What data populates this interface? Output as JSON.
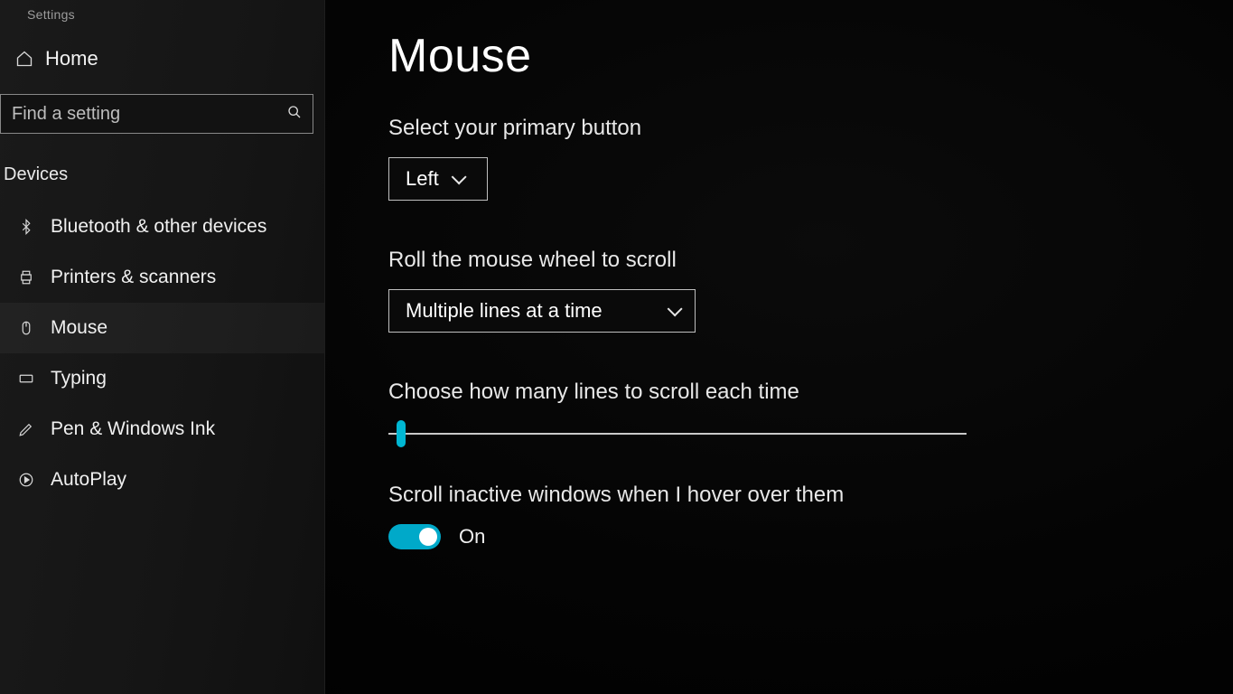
{
  "app": {
    "title": "Settings"
  },
  "sidebar": {
    "home_label": "Home",
    "search_placeholder": "Find a setting",
    "category_label": "Devices",
    "items": [
      {
        "label": "Bluetooth & other devices",
        "icon": "bluetooth"
      },
      {
        "label": "Printers & scanners",
        "icon": "printer"
      },
      {
        "label": "Mouse",
        "icon": "mouse"
      },
      {
        "label": "Typing",
        "icon": "keyboard"
      },
      {
        "label": "Pen & Windows Ink",
        "icon": "pen"
      },
      {
        "label": "AutoPlay",
        "icon": "autoplay"
      }
    ]
  },
  "main": {
    "title": "Mouse",
    "primary_button": {
      "label": "Select your primary button",
      "value": "Left"
    },
    "scroll_mode": {
      "label": "Roll the mouse wheel to scroll",
      "value": "Multiple lines at a time"
    },
    "scroll_lines": {
      "label": "Choose how many lines to scroll each time"
    },
    "scroll_inactive": {
      "label": "Scroll inactive windows when I hover over them",
      "state_label": "On"
    }
  },
  "colors": {
    "accent": "#00b7d3"
  }
}
